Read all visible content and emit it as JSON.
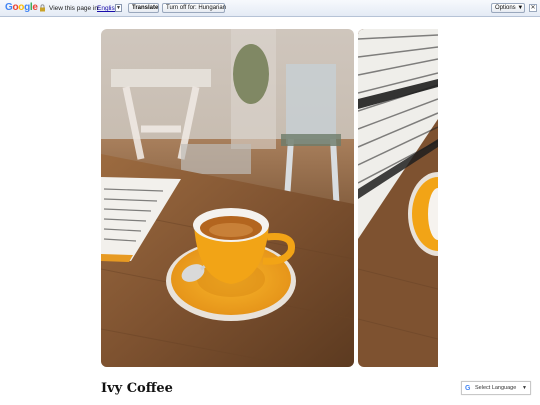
{
  "translate_bar": {
    "logo": "Google",
    "view_text": "View this page in:",
    "language": "English",
    "language_caret": "▼",
    "translate_button": "Translate",
    "turn_off_button": "Turn off for: Hungarian",
    "options_button": "Options ▼",
    "close_symbol": "✕"
  },
  "gallery": {
    "images": [
      "espresso-cup-photo",
      "menu-and-cup-photo"
    ]
  },
  "page": {
    "title": "Ivy Coffee"
  },
  "language_widget": {
    "icon": "G",
    "label": "Select Language",
    "caret": "▼"
  },
  "colors": {
    "cup_orange": "#f2a416",
    "table_wood": "#8a5a33",
    "bar_link": "#1a0dab"
  }
}
